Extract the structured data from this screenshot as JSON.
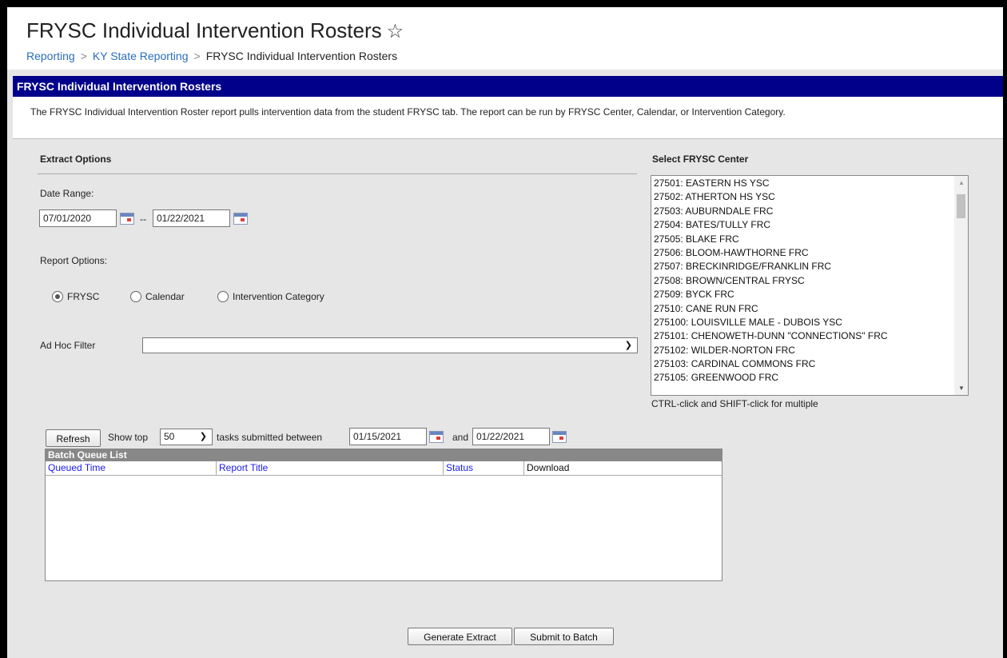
{
  "header": {
    "title": "FRYSC Individual Intervention Rosters",
    "star_icon": "☆",
    "breadcrumb": [
      "Reporting",
      "KY State Reporting",
      "FRYSC Individual Intervention Rosters"
    ],
    "breadcrumb_sep": ">"
  },
  "section": {
    "title": "FRYSC Individual Intervention Rosters",
    "description": "The FRYSC Individual Intervention Roster report pulls intervention data from the student FRYSC tab. The report can be run by FRYSC Center, Calendar, or Intervention Category."
  },
  "extract": {
    "heading": "Extract Options",
    "date_range_label": "Date Range:",
    "start_date": "07/01/2020",
    "date_sep": "--",
    "end_date": "01/22/2021",
    "report_options_label": "Report Options:",
    "radios": [
      {
        "label": "FRYSC",
        "checked": true
      },
      {
        "label": "Calendar",
        "checked": false
      },
      {
        "label": "Intervention Category",
        "checked": false
      }
    ],
    "adhoc_label": "Ad Hoc Filter",
    "adhoc_value": ""
  },
  "center": {
    "heading": "Select FRYSC Center",
    "items": [
      "27501: EASTERN HS YSC",
      "27502: ATHERTON HS YSC",
      "27503: AUBURNDALE FRC",
      "27504: BATES/TULLY FRC",
      "27505: BLAKE FRC",
      "27506: BLOOM-HAWTHORNE FRC",
      "27507: BRECKINRIDGE/FRANKLIN FRC",
      "27508: BROWN/CENTRAL FRYSC",
      "27509: BYCK FRC",
      "27510: CANE RUN FRC",
      "275100: LOUISVILLE MALE - DUBOIS YSC",
      "275101: CHENOWETH-DUNN \"CONNECTIONS\" FRC",
      "275102: WILDER-NORTON FRC",
      "275103: CARDINAL COMMONS FRC",
      "275105: GREENWOOD FRC"
    ],
    "hint": "CTRL-click and SHIFT-click for multiple"
  },
  "batch": {
    "refresh_label": "Refresh",
    "show_top_label": "Show top",
    "show_top_value": "50",
    "between_label": "tasks submitted between",
    "from_date": "01/15/2021",
    "and_label": "and",
    "to_date": "01/22/2021",
    "list_title": "Batch Queue List",
    "columns": [
      "Queued Time",
      "Report Title",
      "Status",
      "Download"
    ]
  },
  "actions": {
    "generate_label": "Generate Extract",
    "submit_label": "Submit to Batch"
  }
}
